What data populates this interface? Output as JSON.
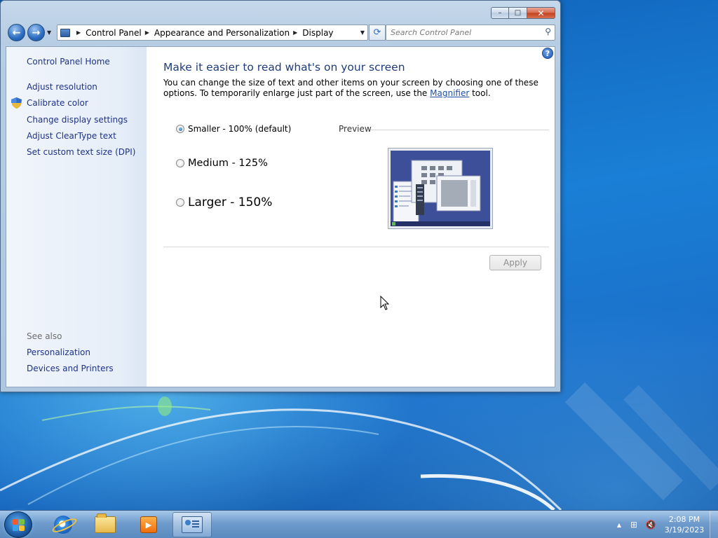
{
  "window": {
    "controls": {
      "minimize": "–",
      "maximize": "□",
      "close": "✕"
    }
  },
  "navigation": {
    "breadcrumbs": [
      "Control Panel",
      "Appearance and Personalization",
      "Display"
    ],
    "search_placeholder": "Search Control Panel"
  },
  "sidebar": {
    "home": "Control Panel Home",
    "links": [
      "Adjust resolution",
      "Calibrate color",
      "Change display settings",
      "Adjust ClearType text",
      "Set custom text size (DPI)"
    ],
    "see_also_heading": "See also",
    "see_also": [
      "Personalization",
      "Devices and Printers"
    ]
  },
  "main": {
    "title": "Make it easier to read what's on your screen",
    "description_before": "You can change the size of text and other items on your screen by choosing one of these options. To temporarily enlarge just part of the screen, use the ",
    "description_link": "Magnifier",
    "description_after": " tool.",
    "options": [
      {
        "label": "Smaller - 100% (default)",
        "selected": true
      },
      {
        "label": "Medium - 125%",
        "selected": false
      },
      {
        "label": "Larger - 150%",
        "selected": false
      }
    ],
    "preview_label": "Preview",
    "apply_label": "Apply",
    "help_label": "?"
  },
  "taskbar": {
    "time": "2:08 PM",
    "date": "3/19/2023",
    "items": [
      "start-button",
      "internet-explorer",
      "windows-explorer",
      "media-player",
      "control-panel"
    ]
  },
  "icons": {
    "shield": "uac-shield-icon",
    "search": "magnifier-icon",
    "refresh": "refresh-icon"
  }
}
